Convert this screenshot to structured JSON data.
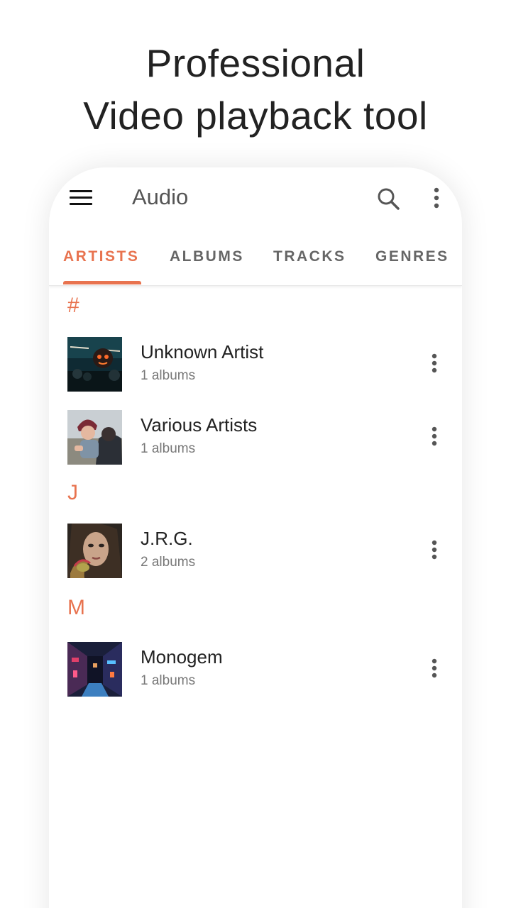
{
  "promo": {
    "line1": "Professional",
    "line2": "Video playback tool"
  },
  "appbar": {
    "title": "Audio",
    "icons": [
      "menu-icon",
      "search-icon",
      "more-vert-icon"
    ]
  },
  "tabs": [
    {
      "label": "ARTISTS",
      "active": true
    },
    {
      "label": "ALBUMS",
      "active": false
    },
    {
      "label": "TRACKS",
      "active": false
    },
    {
      "label": "GENRES",
      "active": false
    }
  ],
  "sections": [
    {
      "letter": "#",
      "items": [
        {
          "name": "Unknown Artist",
          "sub": "1 albums"
        },
        {
          "name": "Various Artists",
          "sub": "1 albums"
        }
      ]
    },
    {
      "letter": "J",
      "items": [
        {
          "name": "J.R.G.",
          "sub": "2 albums"
        }
      ]
    },
    {
      "letter": "M",
      "items": [
        {
          "name": "Monogem",
          "sub": "1 albums"
        }
      ]
    }
  ],
  "colors": {
    "accent": "#e8734f",
    "text_primary": "#222222",
    "text_secondary": "#777777"
  }
}
